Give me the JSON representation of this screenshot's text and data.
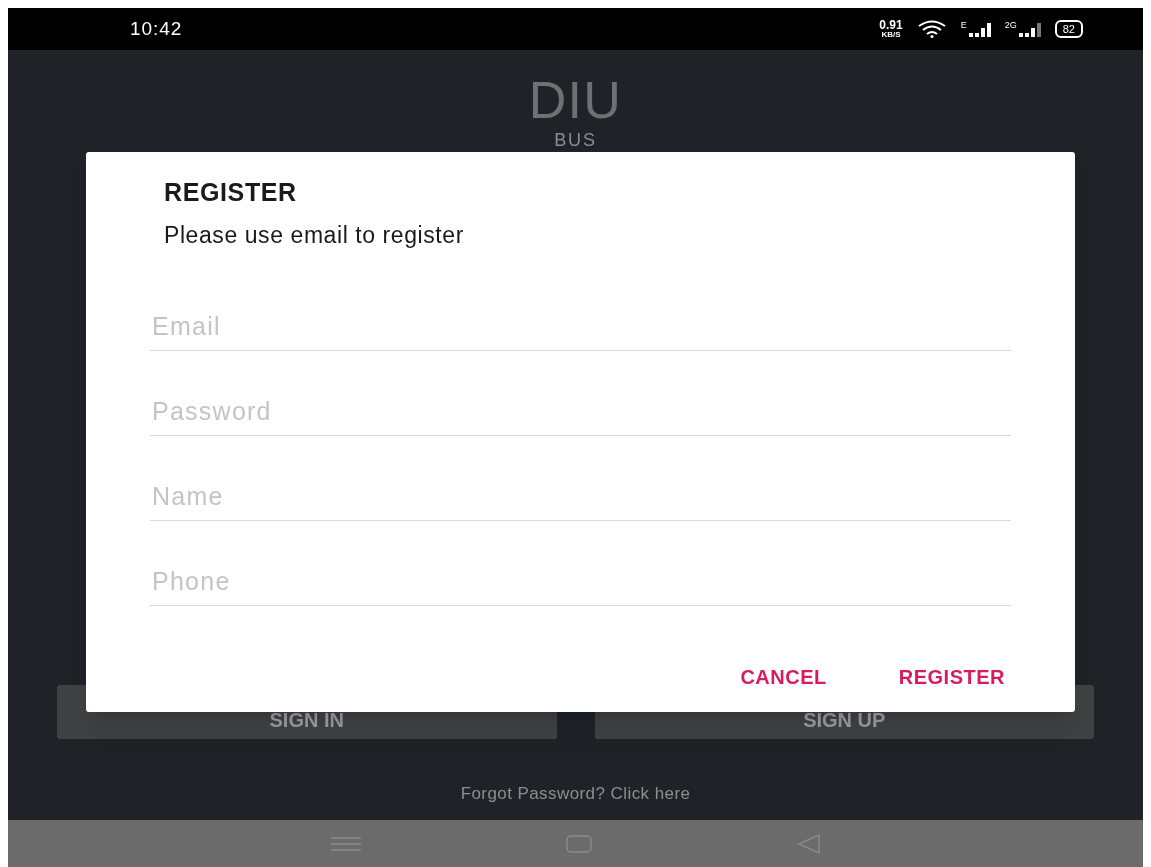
{
  "status_bar": {
    "time": "10:42",
    "speed_value": "0.91",
    "speed_unit": "KB/S",
    "network_1": "E",
    "network_2": "2G",
    "battery": "82"
  },
  "background": {
    "logo": "DIU",
    "subtitle": "BUS",
    "buttons": [
      "SIGN IN",
      "SIGN UP"
    ],
    "forgot_link": "Forgot Password? Click here"
  },
  "dialog": {
    "title": "REGISTER",
    "message": "Please use email to register",
    "fields": [
      {
        "placeholder": "Email"
      },
      {
        "placeholder": "Password"
      },
      {
        "placeholder": "Name"
      },
      {
        "placeholder": "Phone"
      }
    ],
    "buttons": [
      "CANCEL",
      "REGISTER"
    ]
  }
}
